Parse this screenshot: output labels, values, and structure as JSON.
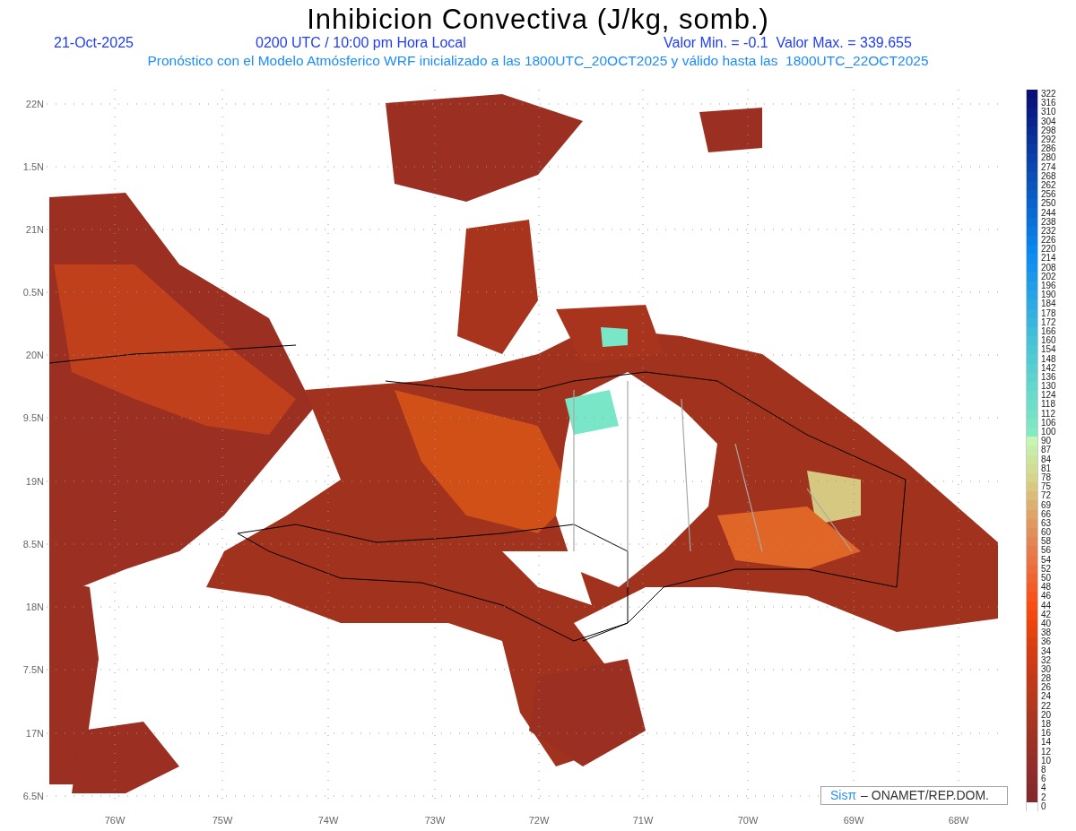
{
  "header": {
    "title": "Inhibicion Convectiva (J/kg, somb.)",
    "date": "21-Oct-2025",
    "time": "0200 UTC / 10:00 pm Hora Local",
    "range": "Valor Min. = -0.1  Valor Max. = 339.655",
    "forecast": "Pronóstico con el Modelo Atmósferico WRF inicializado a las 1800UTC_20OCT2025 y válido hasta las  1800UTC_22OCT2025"
  },
  "map": {
    "y_labels": [
      "22N",
      "1.5N",
      "21N",
      "0.5N",
      "20N",
      "9.5N",
      "19N",
      "8.5N",
      "18N",
      "7.5N",
      "17N",
      "6.5N"
    ],
    "x_labels": [
      "76W",
      "75W",
      "74W",
      "73W",
      "72W",
      "71W",
      "70W",
      "69W",
      "68W"
    ],
    "credit": {
      "logo": "Sisπ",
      "text": "– ONAMET/REP.DOM."
    }
  },
  "colorbar": [
    {
      "label": "322",
      "color": "#0a0f78"
    },
    {
      "label": "316",
      "color": "#0a167f"
    },
    {
      "label": "310",
      "color": "#0a1d86"
    },
    {
      "label": "304",
      "color": "#0a248d"
    },
    {
      "label": "298",
      "color": "#0a2b94"
    },
    {
      "label": "292",
      "color": "#0a329b"
    },
    {
      "label": "286",
      "color": "#0a39a2"
    },
    {
      "label": "280",
      "color": "#0a40a9"
    },
    {
      "label": "274",
      "color": "#0a47b0"
    },
    {
      "label": "268",
      "color": "#0a4eb7"
    },
    {
      "label": "262",
      "color": "#0a55be"
    },
    {
      "label": "256",
      "color": "#0a5cc5"
    },
    {
      "label": "250",
      "color": "#0a63cc"
    },
    {
      "label": "244",
      "color": "#0a6ad3"
    },
    {
      "label": "238",
      "color": "#0a71da"
    },
    {
      "label": "232",
      "color": "#0a78e1"
    },
    {
      "label": "226",
      "color": "#0a7fe8"
    },
    {
      "label": "220",
      "color": "#0a86ef"
    },
    {
      "label": "214",
      "color": "#0f8cf2"
    },
    {
      "label": "208",
      "color": "#1592ef"
    },
    {
      "label": "202",
      "color": "#1b98ec"
    },
    {
      "label": "196",
      "color": "#219ee9"
    },
    {
      "label": "190",
      "color": "#27a4e6"
    },
    {
      "label": "184",
      "color": "#2daae3"
    },
    {
      "label": "178",
      "color": "#33b0e0"
    },
    {
      "label": "172",
      "color": "#39b6dd"
    },
    {
      "label": "166",
      "color": "#3fbcda"
    },
    {
      "label": "160",
      "color": "#45c2d7"
    },
    {
      "label": "154",
      "color": "#4bc6d5"
    },
    {
      "label": "148",
      "color": "#51cad3"
    },
    {
      "label": "142",
      "color": "#57ced1"
    },
    {
      "label": "136",
      "color": "#5dd2cf"
    },
    {
      "label": "130",
      "color": "#63d6cd"
    },
    {
      "label": "124",
      "color": "#69dacb"
    },
    {
      "label": "118",
      "color": "#6fdec9"
    },
    {
      "label": "112",
      "color": "#75e2c7"
    },
    {
      "label": "106",
      "color": "#7be6c5"
    },
    {
      "label": "100",
      "color": "#81eac3"
    },
    {
      "label": "90",
      "color": "#c8f5b0"
    },
    {
      "label": "87",
      "color": "#c8ecaa"
    },
    {
      "label": "84",
      "color": "#cde49c"
    },
    {
      "label": "81",
      "color": "#d2dc92"
    },
    {
      "label": "78",
      "color": "#d6d488"
    },
    {
      "label": "75",
      "color": "#d8c880"
    },
    {
      "label": "72",
      "color": "#dabc78"
    },
    {
      "label": "69",
      "color": "#dcb070"
    },
    {
      "label": "66",
      "color": "#dea468"
    },
    {
      "label": "63",
      "color": "#e09a60"
    },
    {
      "label": "60",
      "color": "#e2905a"
    },
    {
      "label": "58",
      "color": "#e48654"
    },
    {
      "label": "56",
      "color": "#e67c4c"
    },
    {
      "label": "54",
      "color": "#ea7444"
    },
    {
      "label": "52",
      "color": "#ee6c3a"
    },
    {
      "label": "50",
      "color": "#f06430"
    },
    {
      "label": "48",
      "color": "#f45c26"
    },
    {
      "label": "46",
      "color": "#f6541c"
    },
    {
      "label": "44",
      "color": "#f84c14"
    },
    {
      "label": "42",
      "color": "#f4480e"
    },
    {
      "label": "40",
      "color": "#ec440c"
    },
    {
      "label": "38",
      "color": "#e4420e"
    },
    {
      "label": "36",
      "color": "#dc4010"
    },
    {
      "label": "34",
      "color": "#d63e12"
    },
    {
      "label": "32",
      "color": "#d03c14"
    },
    {
      "label": "30",
      "color": "#ca3a16"
    },
    {
      "label": "28",
      "color": "#c43a18"
    },
    {
      "label": "26",
      "color": "#be3a1a"
    },
    {
      "label": "24",
      "color": "#b8391c"
    },
    {
      "label": "22",
      "color": "#b2381e"
    },
    {
      "label": "20",
      "color": "#ac3720"
    },
    {
      "label": "18",
      "color": "#a63622"
    },
    {
      "label": "16",
      "color": "#a03424"
    },
    {
      "label": "14",
      "color": "#9c3226"
    },
    {
      "label": "12",
      "color": "#983028"
    },
    {
      "label": "10",
      "color": "#942e2a"
    },
    {
      "label": "8",
      "color": "#902c2c"
    },
    {
      "label": "6",
      "color": "#8c2a2c"
    },
    {
      "label": "4",
      "color": "#882a2c"
    },
    {
      "label": "2",
      "color": "#84282c"
    },
    {
      "label": "0",
      "color": "#ffffff"
    }
  ]
}
